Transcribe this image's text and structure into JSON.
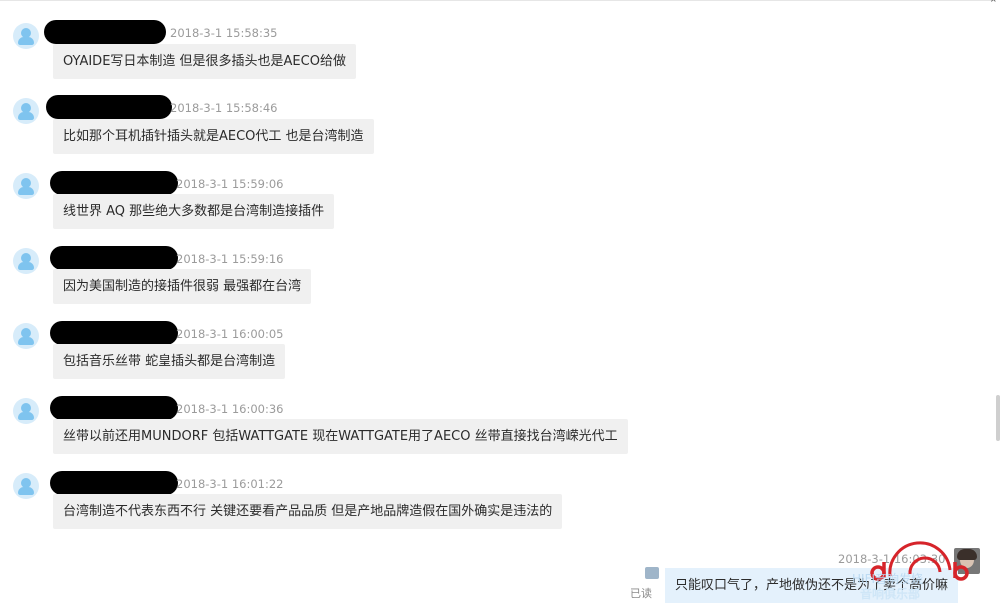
{
  "messages": [
    {
      "time": "2018-3-1 15:58:35",
      "text": "OYAIDE写日本制造 但是很多插头也是AECO给做"
    },
    {
      "time": "2018-3-1 15:58:46",
      "text": "比如那个耳机插针插头就是AECO代工 也是台湾制造"
    },
    {
      "time": "2018-3-1 15:59:06",
      "text": "线世界 AQ 那些绝大多数都是台湾制造接插件"
    },
    {
      "time": "2018-3-1 15:59:16",
      "text": "因为美国制造的接插件很弱 最强都在台湾"
    },
    {
      "time": "2018-3-1 16:00:05",
      "text": "包括音乐丝带 蛇皇插头都是台湾制造"
    },
    {
      "time": "2018-3-1 16:00:36",
      "text": "丝带以前还用MUNDORF 包括WATTGATE 现在WATTGATE用了AECO 丝带直接找台湾嵘光代工"
    },
    {
      "time": "2018-3-1 16:01:22",
      "text": "台湾制造不代表东西不行 关键还要看产品品质 但是产地品牌造假在国外确实是违法的"
    }
  ],
  "self_message": {
    "time": "2018-3-1 16:03:30",
    "text": "只能叹口气了，产地做伪还不是为了卖个高价嘛",
    "read_label": "已读"
  },
  "watermark": {
    "line1": "HIFI音响发烧",
    "line2": "音响俱乐部"
  },
  "colors": {
    "bubble_other": "#f0f0f0",
    "bubble_self": "#e4f1fc",
    "avatar": "#7fc4ef"
  }
}
